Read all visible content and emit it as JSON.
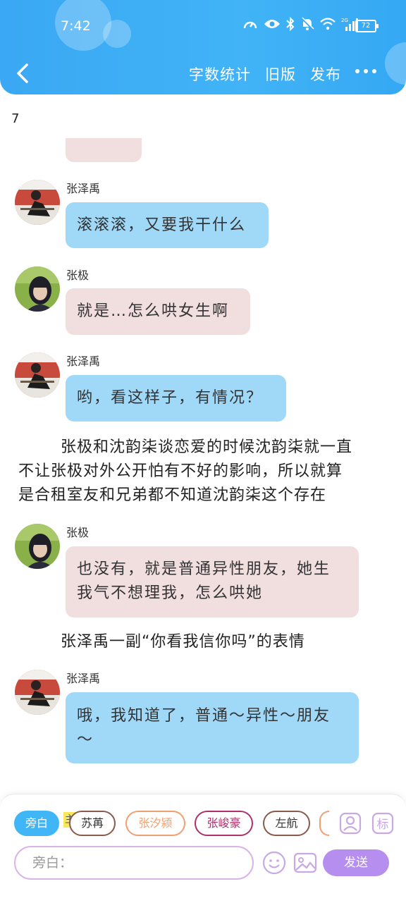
{
  "status_bar": {
    "time": "7:42",
    "battery": "72",
    "network": "2G"
  },
  "nav": {
    "actions": [
      "字数统计",
      "旧版",
      "发布"
    ]
  },
  "chapter_number": "7",
  "messages": [
    {
      "sender": "张泽禹",
      "text": "滚滚滚，又要我干什么"
    },
    {
      "sender": "张极",
      "text": "就是…怎么哄女生啊"
    },
    {
      "sender": "张泽禹",
      "text": "哟，看这样子，有情况？"
    },
    {
      "sender": "张极",
      "line1": "也没有，就是普通异性朋友，她生",
      "line2": "我气不想理我，怎么哄她"
    },
    {
      "sender": "张泽禹",
      "line1": "哦，我知道了，普通～异性～朋友",
      "line2": "～"
    }
  ],
  "narration": {
    "p1_line1": "张极和沈韵柒谈恋爱的时候沈韵柒就一直",
    "p1_line2": "不让张极对外公开怕有不好的影响，所以就算",
    "p1_line3": "是合租室友和兄弟都不知道沈韵柒这个存在",
    "p2": "张泽禹一副“你看我信你吗”的表情"
  },
  "roles": [
    {
      "label": "旁白",
      "color": "#41b6f6"
    },
    {
      "label": "苏苒",
      "color": "#8a5a4a"
    },
    {
      "label": "张汐颍",
      "color": "#f0a070"
    },
    {
      "label": "张峻豪",
      "color": "#b0306a"
    },
    {
      "label": "左航",
      "color": "#8a5a4a"
    }
  ],
  "main_tag": "主",
  "icons": [
    "back-icon",
    "more-icon",
    "person-icon",
    "tag-icon",
    "emoji-icon",
    "image-icon"
  ],
  "input": {
    "placeholder": "旁白："
  },
  "send_label": "发送"
}
